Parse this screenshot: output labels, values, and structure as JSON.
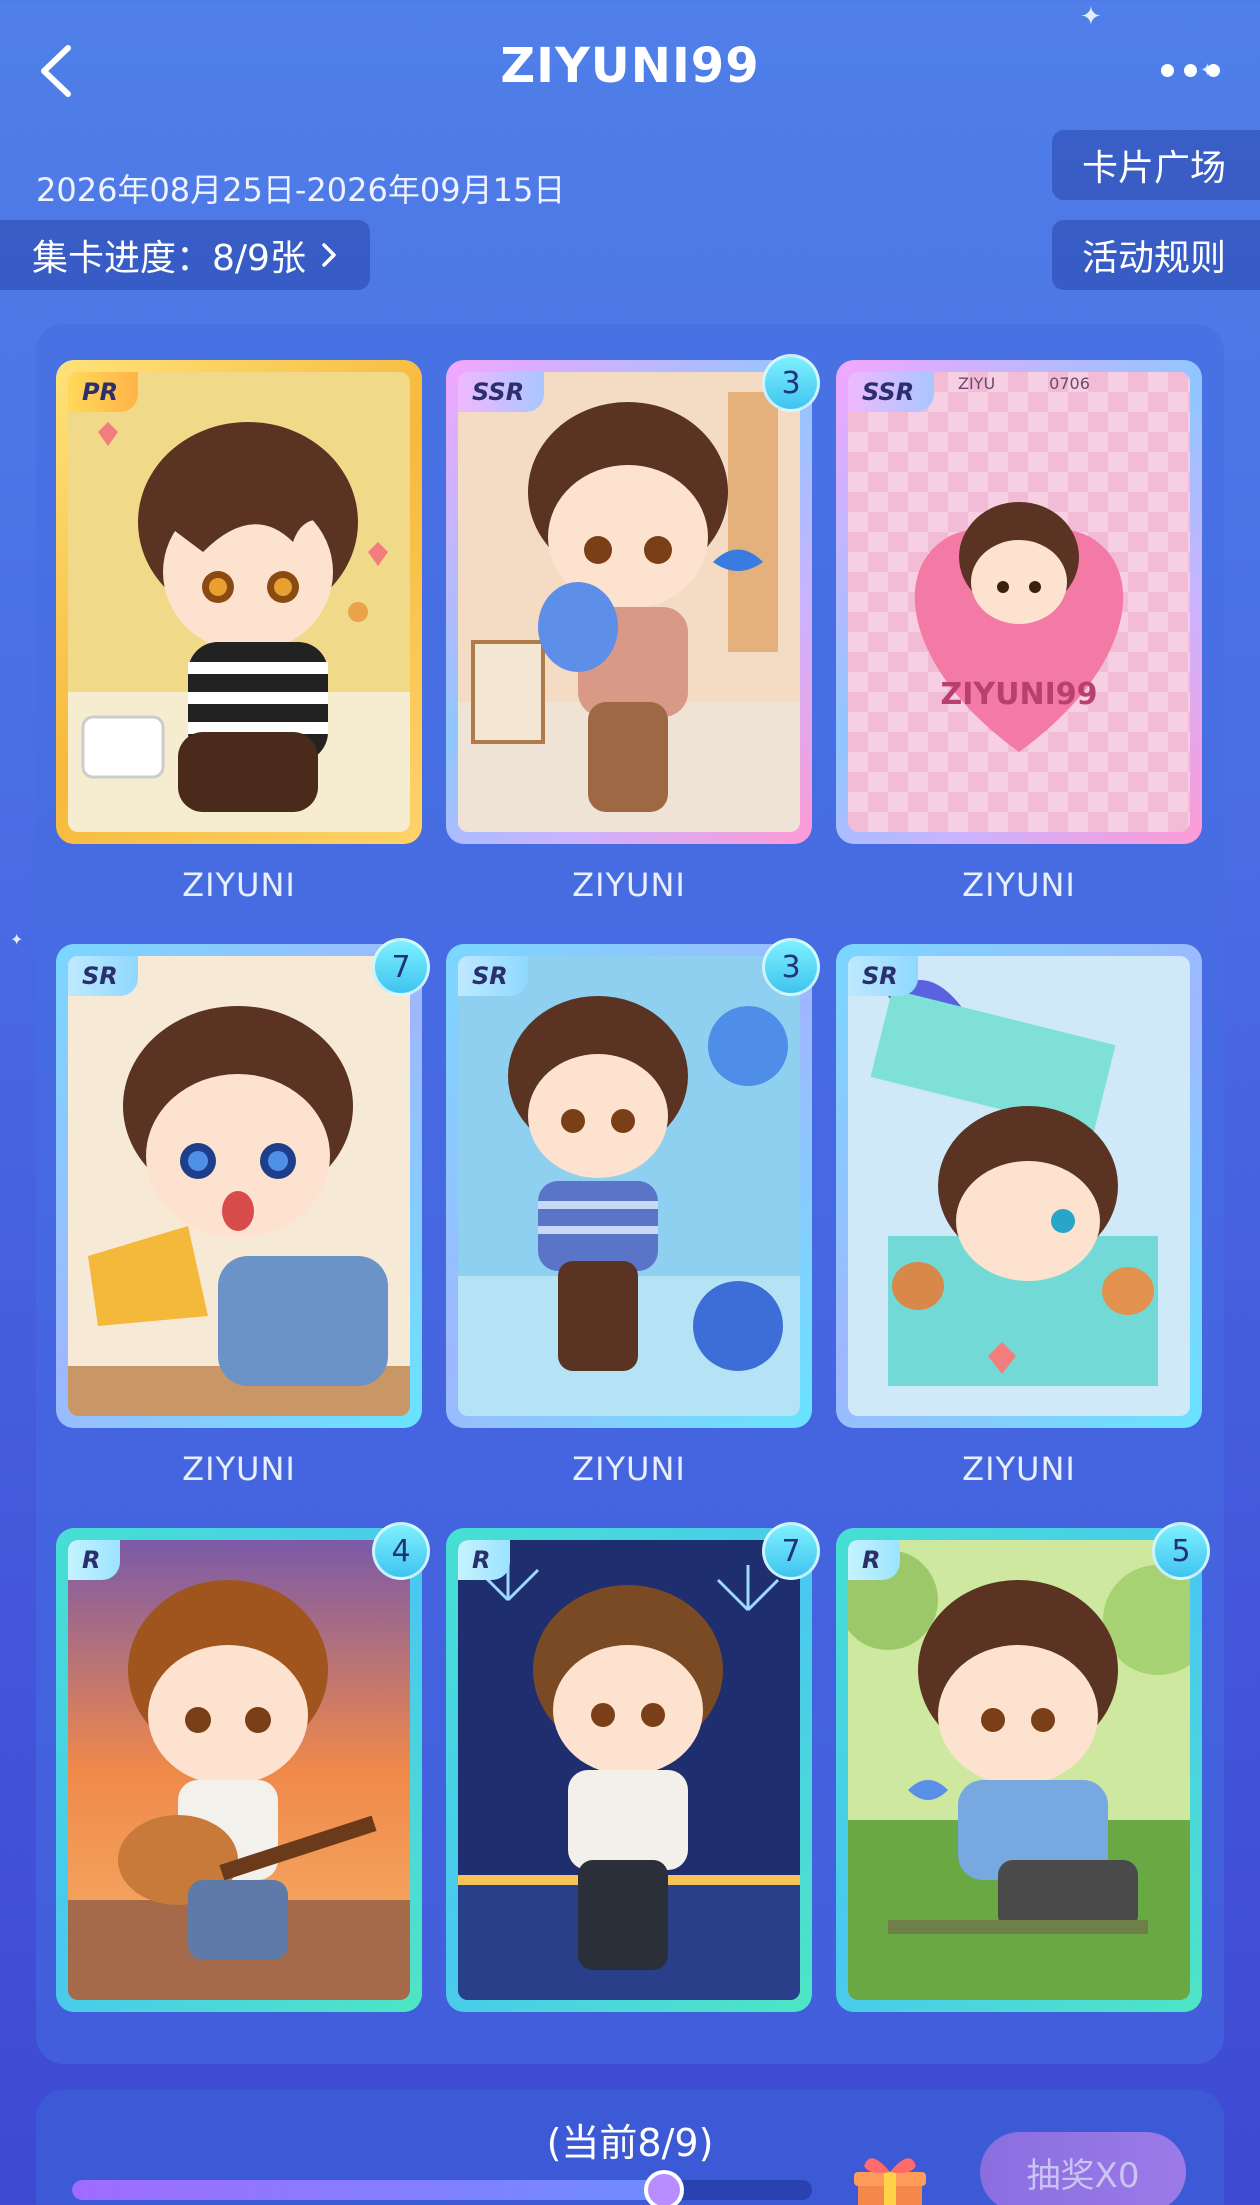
{
  "header": {
    "title": "ZIYUNI99",
    "date_range": "2026年08月25日-2026年09月15日",
    "plaza_button": "卡片广场",
    "rules_button": "活动规则",
    "progress_label": "集卡进度：8/9张"
  },
  "cards": [
    {
      "rarity": "PR",
      "name": "ZIYUNI",
      "count": "",
      "theme": "telephone"
    },
    {
      "rarity": "SSR",
      "name": "ZIYUNI",
      "count": "3",
      "theme": "flowers-bird"
    },
    {
      "rarity": "SSR",
      "name": "ZIYUNI",
      "count": "",
      "theme": "heart-badge",
      "card_text": [
        "ZIYU",
        "0706",
        "ZIYUNI99"
      ]
    },
    {
      "rarity": "SR",
      "name": "ZIYUNI",
      "count": "7",
      "theme": "pizza"
    },
    {
      "rarity": "SR",
      "name": "ZIYUNI",
      "count": "3",
      "theme": "aquarium"
    },
    {
      "rarity": "SR",
      "name": "ZIYUNI",
      "count": "",
      "theme": "gift-box-cats"
    },
    {
      "rarity": "R",
      "name": "ZIYUNI",
      "count": "4",
      "theme": "guitar-sunset"
    },
    {
      "rarity": "R",
      "name": "ZIYUNI",
      "count": "7",
      "theme": "fireworks"
    },
    {
      "rarity": "R",
      "name": "ZIYUNI",
      "count": "5",
      "theme": "garden-bench"
    }
  ],
  "bottom": {
    "current_label": "(当前8/9)",
    "progress_fraction": 0.8,
    "draw_button": "抽奖X0"
  },
  "colors": {
    "accent": "#4a6ee4",
    "badge": "#5fdcf8",
    "draw_button": "#9070e4"
  }
}
